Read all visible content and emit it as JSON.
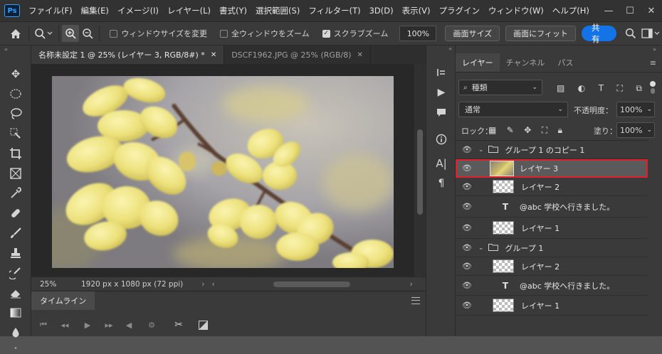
{
  "menubar": {
    "logo": "Ps",
    "items": [
      "ファイル(F)",
      "編集(E)",
      "イメージ(I)",
      "レイヤー(L)",
      "書式(Y)",
      "選択範囲(S)",
      "フィルター(T)",
      "3D(D)",
      "表示(V)",
      "プラグイン",
      "ウィンドウ(W)",
      "ヘルプ(H)"
    ]
  },
  "options": {
    "resize_windows": "ウィンドウサイズを変更",
    "all_windows_zoom": "全ウィンドウをズーム",
    "scrubby_zoom": "スクラブズーム",
    "zoom_value": "100%",
    "fit_screen": "画面サイズ",
    "fill_screen": "画面にフィット",
    "share": "共有"
  },
  "tabs": [
    {
      "label": "名称未設定 1 @ 25% (レイヤー 3, RGB/8#) *",
      "active": true
    },
    {
      "label": "DSCF1962.JPG @ 25% (RGB/8)",
      "active": false
    }
  ],
  "status": {
    "zoom": "25%",
    "dimensions": "1920 px x 1080 px (72 ppi)"
  },
  "timeline": {
    "title": "タイムライン"
  },
  "panel": {
    "tabs": [
      "レイヤー",
      "チャンネル",
      "パス"
    ],
    "filter_kind": "種類",
    "blend_mode": "通常",
    "opacity_label": "不透明度：",
    "opacity_value": "100%",
    "lock_label": "ロック：",
    "fill_label": "塗り：",
    "fill_value": "100%"
  },
  "layers": [
    {
      "name": "グループ 1 のコピー 1",
      "kind": "group",
      "indent": 0
    },
    {
      "name": "レイヤー 3",
      "kind": "image",
      "indent": 1,
      "selected": true
    },
    {
      "name": "レイヤー 2",
      "kind": "pixel",
      "indent": 1
    },
    {
      "name": "@abc 学校へ行きました。",
      "kind": "text",
      "indent": 1
    },
    {
      "name": "レイヤー 1",
      "kind": "pixel",
      "indent": 1
    },
    {
      "name": "グループ 1",
      "kind": "group",
      "indent": 0
    },
    {
      "name": "レイヤー 2",
      "kind": "pixel",
      "indent": 1
    },
    {
      "name": "@abc 学校へ行きました。",
      "kind": "text",
      "indent": 1
    },
    {
      "name": "レイヤー 1",
      "kind": "pixel",
      "indent": 1
    }
  ],
  "colors": {
    "accent": "#1473e6",
    "selection_outline": "#e0202a"
  }
}
